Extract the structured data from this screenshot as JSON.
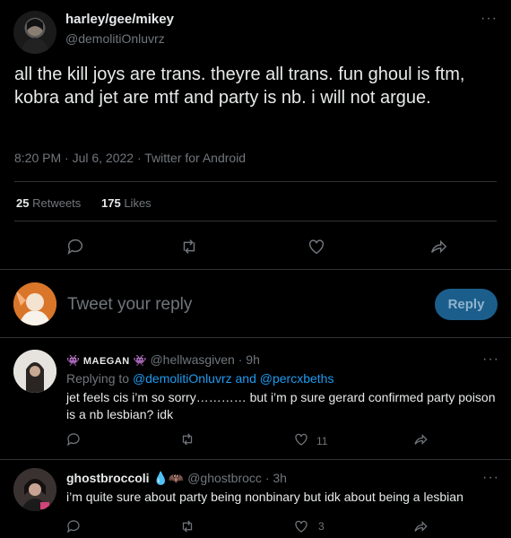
{
  "tweet": {
    "display_name": "harley/gee/mikey",
    "handle": "@demolitiOnluvrz",
    "text": "all the kill joys are trans. theyre all trans. fun ghoul is ftm, kobra and jet are mtf and party is nb. i will not argue.",
    "time": "8:20 PM · Jul 6, 2022 · Twitter for Android",
    "retweets_count": "25",
    "retweets_label": "Retweets",
    "likes_count": "175",
    "likes_label": "Likes",
    "more": "···"
  },
  "composer": {
    "placeholder": "Tweet your reply",
    "reply_button": "Reply"
  },
  "replies": [
    {
      "name": "MAEGAN",
      "handle": "@hellwasgiven",
      "time": "· 9h",
      "replying_prefix": "Replying to ",
      "replying_to": "@demolitiOnluvrz and @percxbeths",
      "text": "jet feels cis i’m so sorry………… but i’m p sure gerard confirmed party poison is a nb lesbian? idk",
      "likes": "11",
      "more": "···"
    },
    {
      "name": "ghostbroccoli",
      "handle": "@ghostbrocc",
      "time": "· 3h",
      "text": "i’m quite sure about party being nonbinary but idk about being a lesbian",
      "likes": "3",
      "more": "···"
    }
  ],
  "colors": {
    "background": "#000000",
    "text": "#e7e9ea",
    "muted": "#71767b",
    "accent": "#1d9bf0",
    "reply_button_bg": "#1b5e8c",
    "divider": "#2f3336"
  },
  "icons": [
    "reply-icon",
    "retweet-icon",
    "like-icon",
    "share-icon",
    "more-icon"
  ]
}
